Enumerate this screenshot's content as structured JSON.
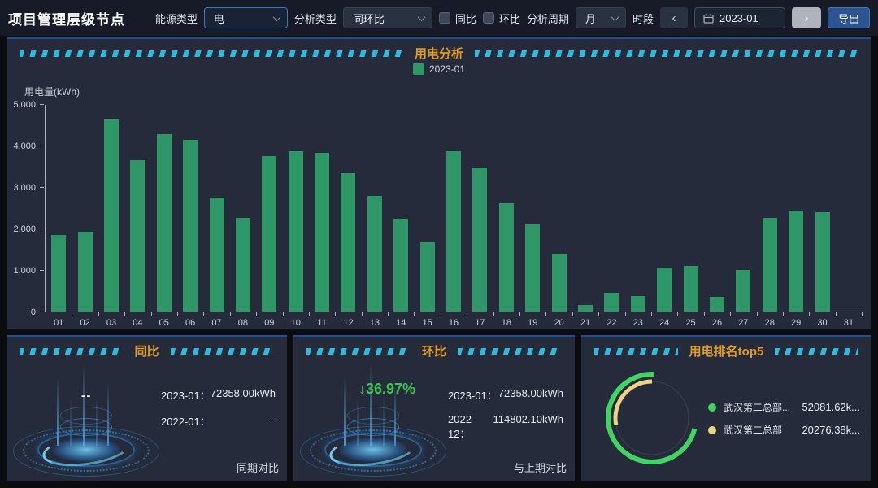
{
  "page": {
    "title": "项目管理层级节点"
  },
  "theme": {
    "stripe_color": "#29c3ea",
    "panel_title_color": "#e39b1e",
    "delta_down_color": "#3ec155",
    "bar_color": "#2e9667"
  },
  "toolbar": {
    "energy_type_label": "能源类型",
    "energy_type_value": "电",
    "analysis_type_label": "分析类型",
    "analysis_type_value": "同环比",
    "yoy_checkbox_label": "同比",
    "mom_checkbox_label": "环比",
    "period_label": "分析周期",
    "period_value": "月",
    "time_label": "时段",
    "prev_icon": "‹",
    "date_value": "2023-01",
    "next_icon": "›",
    "export_label": "导出"
  },
  "chart_data": [
    {
      "type": "bar",
      "title": "用电分析",
      "categories": [
        "01",
        "02",
        "03",
        "04",
        "05",
        "06",
        "07",
        "08",
        "09",
        "10",
        "11",
        "12",
        "13",
        "14",
        "15",
        "16",
        "17",
        "18",
        "19",
        "20",
        "21",
        "22",
        "23",
        "24",
        "25",
        "26",
        "27",
        "28",
        "29",
        "30",
        "31"
      ],
      "series": [
        {
          "name": "2023-01",
          "values": [
            1840,
            1920,
            4650,
            3650,
            4270,
            4130,
            2740,
            2260,
            3750,
            3860,
            3820,
            3330,
            2790,
            2230,
            1660,
            3860,
            3470,
            2600,
            2090,
            1390,
            150,
            460,
            380,
            1060,
            1090,
            360,
            1010,
            2260,
            2440,
            2400,
            0
          ]
        }
      ],
      "xlabel": "",
      "ylabel": "用电量(kWh)",
      "ylim": [
        0,
        5000
      ],
      "ytick_labels": [
        "0",
        "1,000",
        "2,000",
        "3,000",
        "4,000",
        "5,000"
      ],
      "grid": false,
      "legend_position": "top"
    },
    {
      "type": "pie",
      "title": "用电排名top5",
      "labels": [
        "武汉第二总部...",
        "武汉第二总部"
      ],
      "values": [
        52081.62,
        20276.38
      ],
      "total": 72358.0,
      "colors": [
        "#3fd463",
        "#ecd284"
      ],
      "display_values": [
        "52081.62k...",
        "20276.38k..."
      ],
      "legend_position": "right"
    }
  ],
  "yoy_panel": {
    "title": "同比",
    "delta": "--",
    "rows": [
      {
        "label": "2023-01：",
        "value": "72358.00kWh"
      },
      {
        "label": "2022-01：",
        "value": "--"
      }
    ],
    "footer": "同期对比"
  },
  "mom_panel": {
    "title": "环比",
    "delta": "↓36.97%",
    "rows": [
      {
        "label": "2023-01：",
        "value": "72358.00kWh"
      },
      {
        "label": "2022-12：",
        "value": "114802.10kWh"
      }
    ],
    "footer": "与上期对比"
  },
  "top5_panel": {
    "title": "用电排名top5",
    "legend": [
      {
        "name": "武汉第二总部...",
        "value": "52081.62k...",
        "color": "#3fd463"
      },
      {
        "name": "武汉第二总部",
        "value": "20276.38k...",
        "color": "#ecd284"
      }
    ]
  }
}
